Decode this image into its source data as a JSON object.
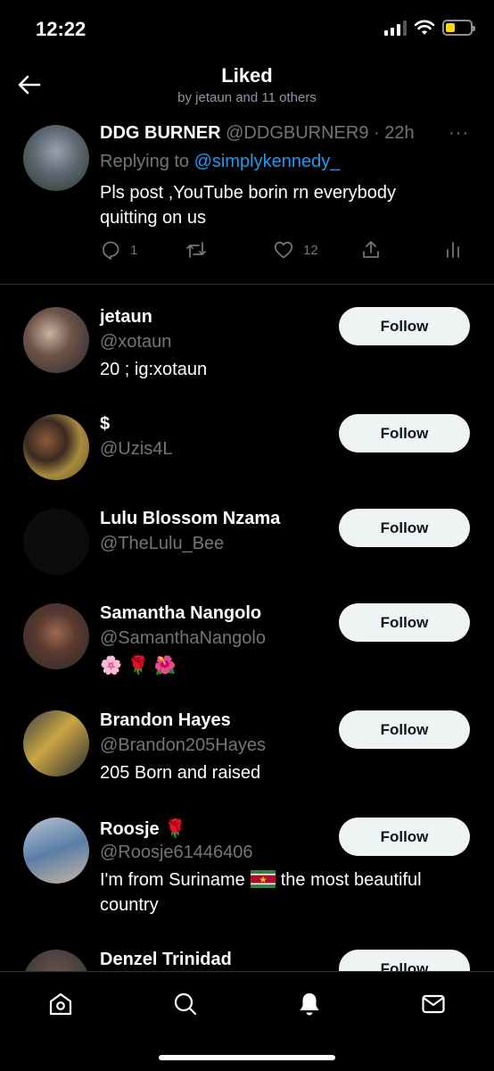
{
  "status_bar": {
    "time": "12:22",
    "battery_color": "#ffd60a"
  },
  "header": {
    "title": "Liked",
    "subtitle": "by jetaun and 11 others",
    "back_icon": "arrow-left-icon"
  },
  "tweet": {
    "name": "DDG BURNER",
    "handle": "@DDGBURNER9",
    "separator": "·",
    "time": "22h",
    "more": "···",
    "replying_prefix": "Replying to",
    "replying_to": "@simplykennedy_",
    "text": "Pls post ,YouTube borin rn everybody quitting on us",
    "reply_count": "1",
    "retweet_count": "",
    "like_count": "12"
  },
  "users": [
    {
      "name": "jetaun",
      "handle": "@xotaun",
      "bio": "20 ; ig:xotaun",
      "follow_label": "Follow"
    },
    {
      "name": "$",
      "handle": "@Uzis4L",
      "bio": "",
      "follow_label": "Follow"
    },
    {
      "name": "Lulu Blossom Nzama",
      "handle": "@TheLulu_Bee",
      "bio": "",
      "follow_label": "Follow"
    },
    {
      "name": "Samantha Nangolo",
      "handle": "@SamanthaNangolo",
      "bio": "🌸 🌹 🌺",
      "follow_label": "Follow"
    },
    {
      "name": "Brandon Hayes",
      "handle": "@Brandon205Hayes",
      "bio": "205 Born and raised",
      "follow_label": "Follow"
    },
    {
      "name": "Roosje 🌹",
      "handle": "@Roosje61446406",
      "bio_part1": "I'm from Suriname",
      "bio_part2": "the most beautiful country",
      "follow_label": "Follow"
    },
    {
      "name": "Denzel Trinidad",
      "handle": "",
      "bio": "",
      "follow_label": "Follow"
    }
  ],
  "colors": {
    "accent": "#1d9bf0",
    "muted": "#71767b",
    "button_bg": "#eff3f4"
  },
  "bottom_nav": [
    "home-icon",
    "search-icon",
    "notifications-icon",
    "messages-icon"
  ]
}
